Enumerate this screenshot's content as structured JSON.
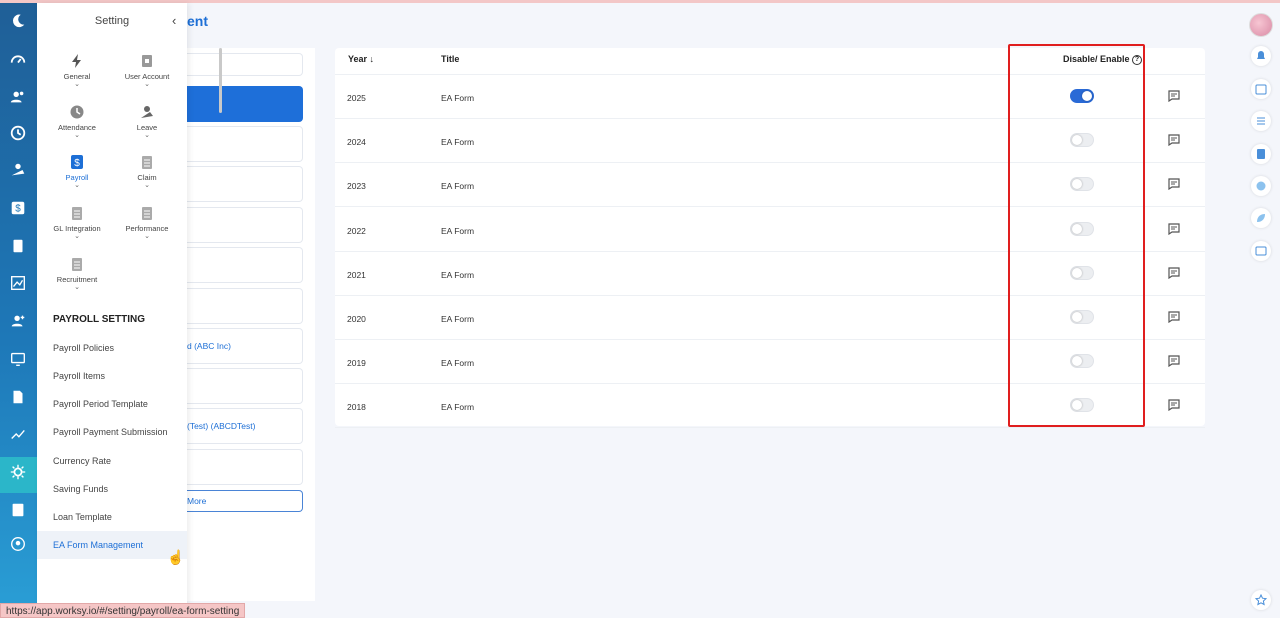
{
  "app": {
    "page_title_partial": "ent"
  },
  "left_rail": {
    "icons": [
      "moon-logo-icon",
      "dashboard-icon",
      "users-icon",
      "clock-icon",
      "leave-icon",
      "dollar-icon",
      "clipboard-icon",
      "chart-icon",
      "user-add-icon",
      "monitor-icon",
      "document-icon",
      "trend-icon",
      "gear-icon",
      "file-icon",
      "badge-icon"
    ]
  },
  "settings_panel": {
    "title": "Setting",
    "categories": [
      {
        "label": "General",
        "icon": "lightning-icon"
      },
      {
        "label": "User Account",
        "icon": "lock-icon"
      },
      {
        "label": "Attendance",
        "icon": "clock-icon"
      },
      {
        "label": "Leave",
        "icon": "beach-icon"
      },
      {
        "label": "Payroll",
        "icon": "dollar-doc-icon"
      },
      {
        "label": "Claim",
        "icon": "clipboard-icon"
      },
      {
        "label": "GL Integration",
        "icon": "clipboard-icon"
      },
      {
        "label": "Performance",
        "icon": "clipboard-icon"
      },
      {
        "label": "Recruitment",
        "icon": "clipboard-icon"
      }
    ],
    "section_heading": "PAYROLL SETTING",
    "menu_items": [
      "Payroll Policies",
      "Payroll Items",
      "Payroll Period Template",
      "Payroll Payment Submission",
      "Currency Rate",
      "Saving Funds",
      "Loan Template",
      "EA Form Management"
    ],
    "active_item": "EA Form Management"
  },
  "middle_panel": {
    "company_1": "d (ABC Inc)",
    "company_2": "(Test) (ABCDTest)",
    "more_label": "More"
  },
  "table": {
    "columns": {
      "year": "Year",
      "title": "Title",
      "toggle": "Disable/ Enable"
    },
    "rows": [
      {
        "year": "2025",
        "title": "EA Form",
        "enabled": true
      },
      {
        "year": "2024",
        "title": "EA Form",
        "enabled": false
      },
      {
        "year": "2023",
        "title": "EA Form",
        "enabled": false
      },
      {
        "year": "2022",
        "title": "EA Form",
        "enabled": false
      },
      {
        "year": "2021",
        "title": "EA Form",
        "enabled": false
      },
      {
        "year": "2020",
        "title": "EA Form",
        "enabled": false
      },
      {
        "year": "2019",
        "title": "EA Form",
        "enabled": false
      },
      {
        "year": "2018",
        "title": "EA Form",
        "enabled": false
      }
    ]
  },
  "status_bar": {
    "url": "https://app.worksy.io/#/setting/payroll/ea-form-setting"
  },
  "colors": {
    "accent": "#1d6fd6",
    "highlight": "#e01e1e",
    "rail": "#1e78b8"
  }
}
